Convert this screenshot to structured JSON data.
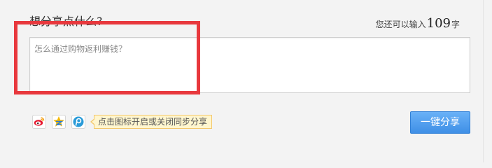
{
  "composer": {
    "prompt": "想分享点什么?",
    "counter_prefix": "您还可以输入",
    "counter_value": "109",
    "counter_suffix": "字",
    "placeholder": "怎么通过购物返利赚钱？"
  },
  "share_targets": [
    {
      "name": "weibo",
      "icon": "sina-weibo-icon",
      "color": "#e6162d"
    },
    {
      "name": "qzone",
      "icon": "qq-zone-icon",
      "color": "#f5b800"
    },
    {
      "name": "tencent-weibo",
      "icon": "tencent-weibo-icon",
      "color": "#2a9bd8"
    }
  ],
  "tooltip": "点击图标开启或关闭同步分享",
  "submit_label": "一键分享",
  "colors": {
    "highlight_border": "#e8383d",
    "button_blue": "#4a97ea"
  }
}
